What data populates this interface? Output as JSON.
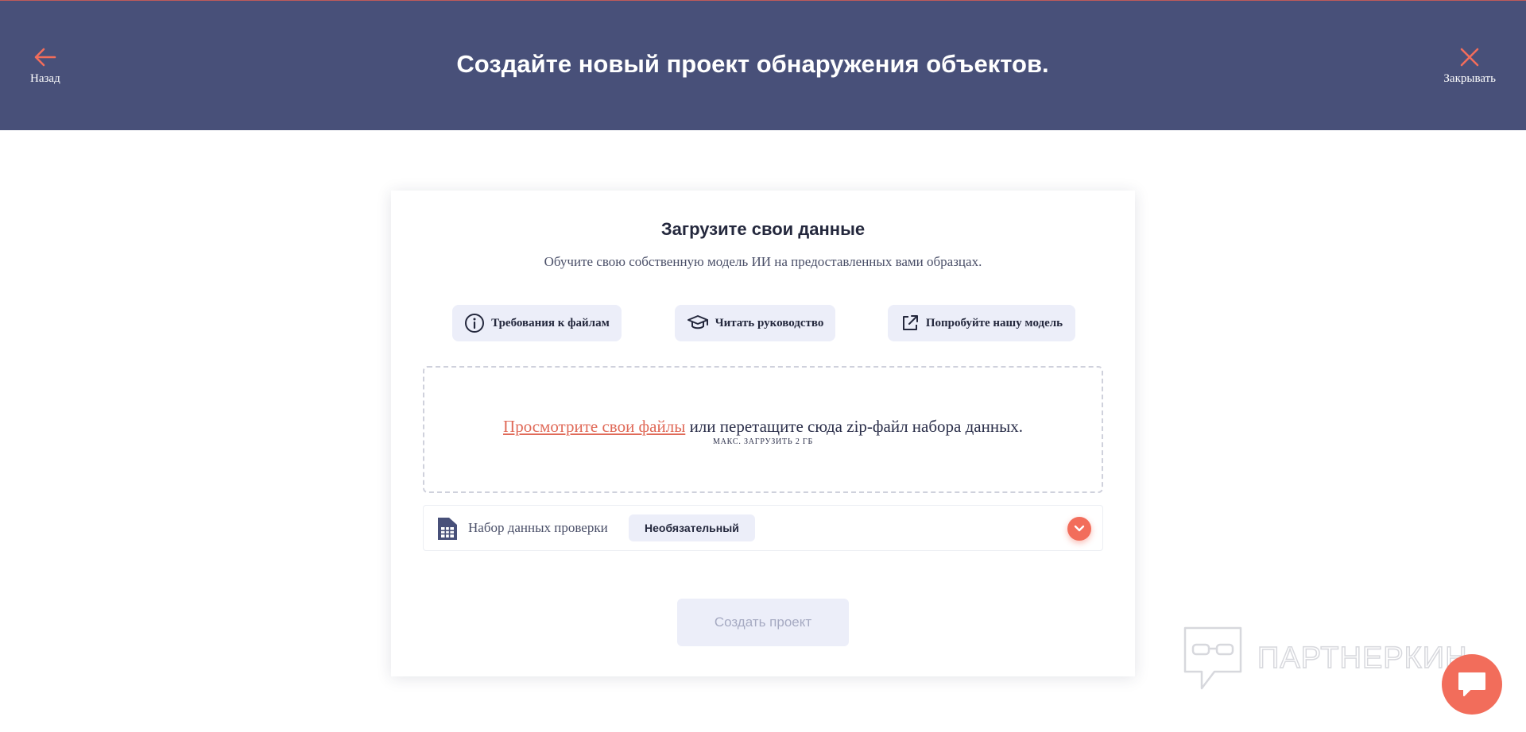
{
  "header": {
    "back_label": "Назад",
    "title": "Создайте новый проект обнаружения объектов.",
    "close_label": "Закрывать"
  },
  "card": {
    "title": "Загрузите свои данные",
    "subtitle": "Обучите свою собственную модель ИИ на предоставленных вами образцах.",
    "pills": [
      {
        "label": "Требования к файлам",
        "icon": "info-icon"
      },
      {
        "label": "Читать руководство",
        "icon": "graduation-cap-icon"
      },
      {
        "label": "Попробуйте нашу модель",
        "icon": "external-link-icon"
      }
    ],
    "dropzone": {
      "browse_link": "Просмотрите свои файлы",
      "drop_text": " или перетащите сюда zip-файл набора данных.",
      "max_upload": "МАКС. ЗАГРУЗИТЬ 2 ГБ"
    },
    "validation": {
      "label": "Набор данных проверки",
      "badge": "Необязательный"
    },
    "create_button": "Создать проект"
  },
  "watermark": {
    "text": "ПАРТНЕРКИН"
  },
  "colors": {
    "header_bg": "#485079",
    "accent": "#f26d5b",
    "pill_bg": "#eceef9",
    "disabled_text": "#a6aac2"
  }
}
